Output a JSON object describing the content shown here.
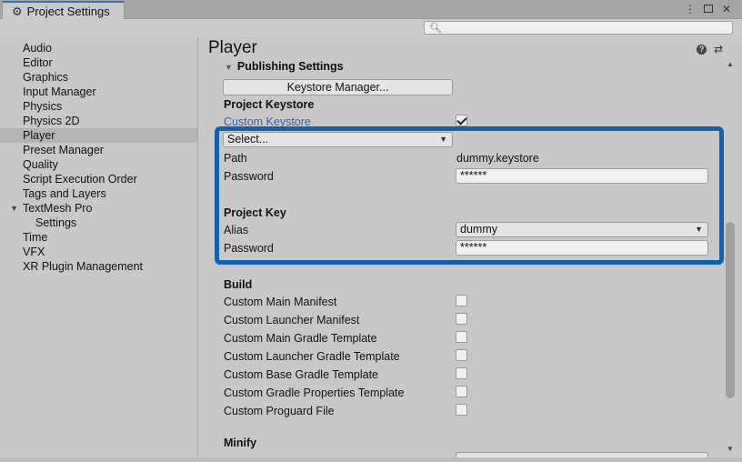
{
  "window": {
    "tab_title": "Project Settings",
    "controls": [
      "⋮",
      "□",
      "✕"
    ]
  },
  "search": {
    "value": "",
    "placeholder": ""
  },
  "sidebar": {
    "items": [
      {
        "label": "Audio"
      },
      {
        "label": "Editor"
      },
      {
        "label": "Graphics"
      },
      {
        "label": "Input Manager"
      },
      {
        "label": "Physics"
      },
      {
        "label": "Physics 2D"
      },
      {
        "label": "Player",
        "selected": true
      },
      {
        "label": "Preset Manager"
      },
      {
        "label": "Quality"
      },
      {
        "label": "Script Execution Order"
      },
      {
        "label": "Tags and Layers"
      },
      {
        "label": "TextMesh Pro",
        "expanded": true
      },
      {
        "label": "Settings",
        "child": true
      },
      {
        "label": "Time"
      },
      {
        "label": "VFX"
      },
      {
        "label": "XR Plugin Management"
      }
    ]
  },
  "main": {
    "title": "Player",
    "header_icons": [
      "help-icon",
      "preset-icon",
      "gear-icon"
    ],
    "publishing_settings": {
      "label": "Publishing Settings",
      "keystore_manager_button": "Keystore Manager...",
      "project_keystore": {
        "heading": "Project Keystore",
        "custom_keystore_label": "Custom Keystore",
        "custom_keystore_checked": true,
        "select_dropdown": "Select...",
        "path_label": "Path",
        "path_value": "dummy.keystore",
        "password_label": "Password",
        "password_value": "******"
      },
      "project_key": {
        "heading": "Project Key",
        "alias_label": "Alias",
        "alias_value": "dummy",
        "password_label": "Password",
        "password_value": "******"
      },
      "build": {
        "heading": "Build",
        "options": [
          {
            "label": "Custom Main Manifest",
            "checked": false
          },
          {
            "label": "Custom Launcher Manifest",
            "checked": false
          },
          {
            "label": "Custom Main Gradle Template",
            "checked": false
          },
          {
            "label": "Custom Launcher Gradle Template",
            "checked": false
          },
          {
            "label": "Custom Base Gradle Template",
            "checked": false
          },
          {
            "label": "Custom Gradle Properties Template",
            "checked": false
          },
          {
            "label": "Custom Proguard File",
            "checked": false
          }
        ]
      },
      "minify": {
        "heading": "Minify"
      }
    }
  },
  "colors": {
    "highlight_border": "#0e62b4",
    "selected_item": "#b4b4b4",
    "link": "#3a5fa0"
  }
}
